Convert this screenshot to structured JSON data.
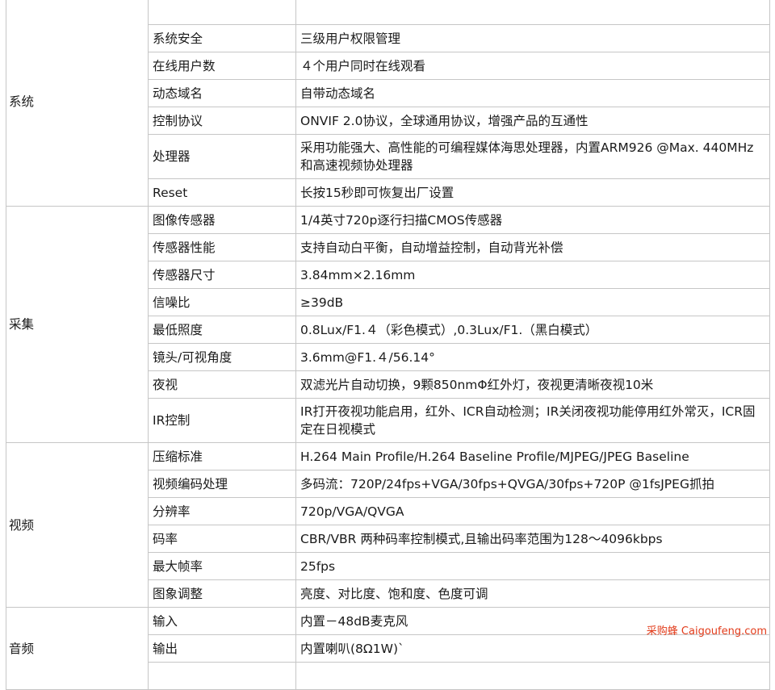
{
  "groups": [
    {
      "name": "系统",
      "rows": [
        {
          "param": "",
          "value": "",
          "h": 34
        },
        {
          "param": "系统安全",
          "value": "三级用户权限管理",
          "h": 34
        },
        {
          "param": "在线用户数",
          "value": "４个用户同时在线观看",
          "h": 34
        },
        {
          "param": "动态域名",
          "value": "自带动态域名",
          "h": 34
        },
        {
          "param": "控制协议",
          "value": "ONVIF 2.0协议，全球通用协议，增强产品的互通性",
          "h": 34
        },
        {
          "param": "处理器",
          "value": "采用功能强大、高性能的可编程媒体海思处理器，内置ARM926 @Max. 440MHz和高速视频协处理器",
          "h": 44,
          "multi": true
        },
        {
          "param": "Reset",
          "value": "长按15秒即可恢复出厂设置",
          "h": 34
        }
      ]
    },
    {
      "name": "采集",
      "rows": [
        {
          "param": "图像传感器",
          "value": "1/4英寸720p逐行扫描CMOS传感器",
          "h": 34
        },
        {
          "param": "传感器性能",
          "value": "支持自动白平衡，自动增益控制，自动背光补偿",
          "h": 34
        },
        {
          "param": "传感器尺寸",
          "value": "3.84mm×2.16mm",
          "h": 34
        },
        {
          "param": "信噪比",
          "value": "≥39dB",
          "h": 34
        },
        {
          "param": "最低照度",
          "value": "0.8Lux/F1.４（彩色模式）,0.3Lux/F1.（黑白模式）",
          "h": 34
        },
        {
          "param": "镜头/可视角度",
          "value": "3.6mm@F1.４/56.14°",
          "h": 34
        },
        {
          "param": "夜视",
          "value": "双滤光片自动切换，9颗850nmΦ红外灯，夜视更清晰夜视10米",
          "h": 34
        },
        {
          "param": "IR控制",
          "value": "IR打开夜视功能启用，红外、ICR自动检测；IR关闭夜视功能停用红外常灭，ICR固定在日视模式",
          "h": 44,
          "multi": true
        }
      ]
    },
    {
      "name": "视频",
      "rows": [
        {
          "param": "压缩标准",
          "value": "H.264 Main Profile/H.264 Baseline Profile/MJPEG/JPEG Baseline",
          "h": 34
        },
        {
          "param": "视频编码处理",
          "value": "多码流：720P/24fps+VGA/30fps+QVGA/30fps+720P @1fsJPEG抓拍",
          "h": 34
        },
        {
          "param": "分辨率",
          "value": "720p/VGA/QVGA",
          "h": 34
        },
        {
          "param": "码率",
          "value": "CBR/VBR 两种码率控制模式,且输出码率范围为128～4096kbps",
          "h": 34
        },
        {
          "param": "最大帧率",
          "value": "25fps",
          "h": 34
        },
        {
          "param": "图象调整",
          "value": "亮度、对比度、饱和度、色度可调",
          "h": 34
        }
      ]
    },
    {
      "name": "音频",
      "rows": [
        {
          "param": "输入",
          "value": "内置－48dB麦克风",
          "h": 34
        },
        {
          "param": "输出",
          "value": "内置喇叭(8Ω1W)`",
          "h": 34
        },
        {
          "param": "",
          "value": "",
          "h": 34
        }
      ]
    }
  ],
  "watermark": {
    "cn": "采购蜂",
    "en": "Caigoufeng.com"
  }
}
